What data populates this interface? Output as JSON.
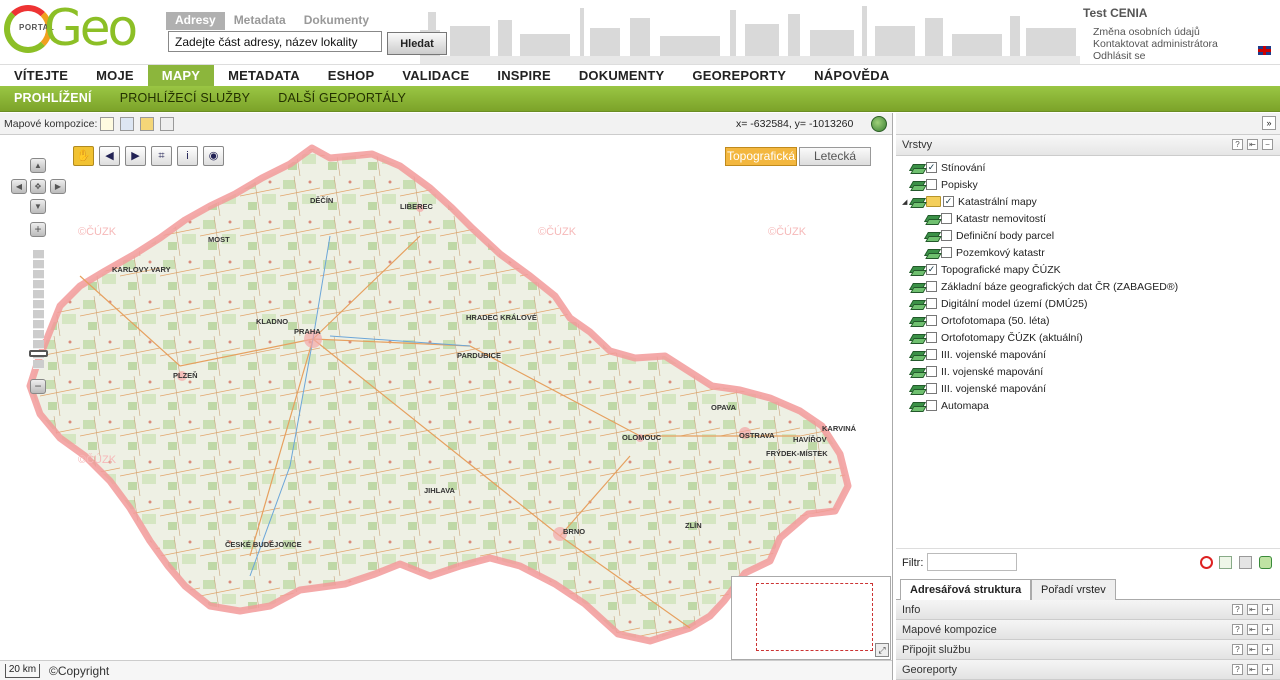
{
  "header": {
    "logo_small_text": "PORTAL",
    "logo_big_text": "Geo",
    "search_tabs": [
      "Adresy",
      "Metadata",
      "Dokumenty"
    ],
    "search_placeholder": "Zadejte část adresy, název lokality",
    "search_button": "Hledat",
    "user_name": "Test CENIA",
    "user_links": [
      "Změna osobních údajů",
      "Kontaktovat administrátora",
      "Odhlásit se"
    ]
  },
  "main_nav": [
    "VÍTEJTE",
    "MOJE",
    "MAPY",
    "METADATA",
    "ESHOP",
    "VALIDACE",
    "INSPIRE",
    "DOKUMENTY",
    "GEOREPORTY",
    "NÁPOVĚDA"
  ],
  "sub_nav": [
    "PROHLÍŽENÍ",
    "PROHLÍŽECÍ SLUŽBY",
    "DALŠÍ GEOPORTÁLY"
  ],
  "map": {
    "compositions_label": "Mapové kompozice:",
    "coords": "x= -632584, y= -1013260",
    "basemap_buttons": [
      "Topografická",
      "Letecká"
    ],
    "watermark": "©ČÚZK",
    "scale_label": "20 km",
    "copyright": "©Copyright",
    "city_labels": [
      "DĚČÍN",
      "LIBEREC",
      "MOST",
      "KARLOVY VARY",
      "KLADNO",
      "PRAHA",
      "HRADEC KRÁLOVÉ",
      "PARDUBICE",
      "PLZEŇ",
      "JIHLAVA",
      "ČESKÉ BUDĚJOVICE",
      "BRNO",
      "OLOMOUC",
      "OPAVA",
      "OSTRAVA",
      "HAVÍŘOV",
      "KARVINÁ",
      "FRÝDEK-MÍSTEK",
      "ZLÍN"
    ]
  },
  "layers_panel": {
    "title": "Vrstvy",
    "layers": [
      {
        "label": "Stínování",
        "checked": true,
        "indent": 0
      },
      {
        "label": "Popisky",
        "checked": false,
        "indent": 0
      },
      {
        "label": "Katastrální mapy",
        "checked": true,
        "indent": 0,
        "folder": true
      },
      {
        "label": "Katastr nemovitostí",
        "checked": false,
        "indent": 1
      },
      {
        "label": "Definiční body parcel",
        "checked": false,
        "indent": 1
      },
      {
        "label": "Pozemkový katastr",
        "checked": false,
        "indent": 1
      },
      {
        "label": "Topografické mapy ČÚZK",
        "checked": true,
        "indent": 0
      },
      {
        "label": "Základní báze geografických dat ČR (ZABAGED®)",
        "checked": false,
        "indent": 0
      },
      {
        "label": "Digitální model území (DMÚ25)",
        "checked": false,
        "indent": 0
      },
      {
        "label": "Ortofotomapa (50. léta)",
        "checked": false,
        "indent": 0
      },
      {
        "label": "Ortofotomapy ČÚZK (aktuální)",
        "checked": false,
        "indent": 0
      },
      {
        "label": "III. vojenské mapování",
        "checked": false,
        "indent": 0
      },
      {
        "label": "II. vojenské mapování",
        "checked": false,
        "indent": 0
      },
      {
        "label": "III. vojenské mapování",
        "checked": false,
        "indent": 0
      },
      {
        "label": "Automapa",
        "checked": false,
        "indent": 0
      }
    ],
    "filter_label": "Filtr:",
    "tabs": [
      "Adresářová struktura",
      "Pořadí vrstev"
    ]
  },
  "accordion": [
    "Info",
    "Mapové kompozice",
    "Připojit službu",
    "Georeporty"
  ],
  "colors": {
    "accent_green": "#8cb63c",
    "topo_orange": "#f3b73f",
    "map_border": "#f29a9a"
  }
}
